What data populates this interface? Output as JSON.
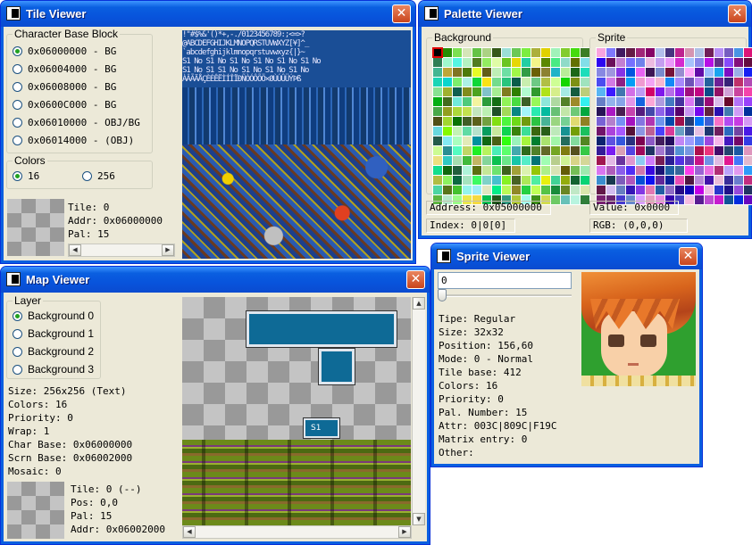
{
  "tile_viewer": {
    "title": "Tile Viewer",
    "char_base_legend": "Character Base Block",
    "char_bases": [
      "0x06000000 - BG",
      "0x06004000 - BG",
      "0x06008000 - BG",
      "0x0600C000 - BG",
      "0x06010000 - OBJ/BG",
      "0x06014000 - (OBJ)"
    ],
    "selected_char_base": 0,
    "colors_legend": "Colors",
    "color_options": [
      "16",
      "256"
    ],
    "selected_color": 0,
    "tile": "Tile: 0",
    "addr": "Addr: 0x06000000",
    "pal": "Pal: 15",
    "tile_text_rows": [
      " !\"#$%&'()*+,-./0123456789:;<=>?",
      "@ABCDEFGHIJKLMNOPQRSTUVWXYZ[¥]^_",
      "`abcdefghijklmnopqrstuvwxyz{|}~",
      "S1 No S1 No S1 No S1 No S1 No S1 No",
      "S1 No S1      S1 No S1 No S1 No S1 No",
      "ÀÂÃÄÅÇÈÉÊËÌÍÎÏÐÑÒÓÔÕÖ×ØÙÚÛÜÝÞß"
    ]
  },
  "palette_viewer": {
    "title": "Palette Viewer",
    "background_legend": "Background",
    "sprite_legend": "Sprite",
    "address": "Address: 0x05000000",
    "index": "Index: 0|0[0]",
    "value": "Value: 0x0000",
    "rgb": "RGB: (0,0,0)"
  },
  "map_viewer": {
    "title": "Map Viewer",
    "layer_legend": "Layer",
    "layers": [
      "Background 0",
      "Background 1",
      "Background 2",
      "Background 3"
    ],
    "selected_layer": 0,
    "size": "Size: 256x256 (Text)",
    "colors": "Colors: 16",
    "priority": "Priority: 0",
    "wrap": "Wrap: 1",
    "char_base": "Char Base: 0x06000000",
    "scrn_base": "Scrn Base: 0x06002000",
    "mosaic": "Mosaic: 0",
    "tile": "Tile: 0 (--)",
    "pos": "Pos: 0,0",
    "pal": "Pal: 15",
    "addr": "Addr: 0x06002000",
    "map_label": "S1"
  },
  "sprite_viewer": {
    "title": "Sprite Viewer",
    "sprite_number": "0",
    "info": [
      "Tipe: Regular",
      "Size: 32x32",
      "Position: 156,60",
      "Mode: 0 - Normal",
      "Tile base: 412",
      "Colors: 16",
      "Priority: 0",
      "Pal. Number: 15",
      "Attr: 003C|809C|F19C",
      "Matrix entry: 0",
      "Other:"
    ]
  },
  "icons": {
    "close": "close-icon",
    "app": "app-icon"
  },
  "colors": {
    "titlebar": "#0a5fe0",
    "window_bg": "#ece9d8",
    "close_button": "#d65a30"
  }
}
